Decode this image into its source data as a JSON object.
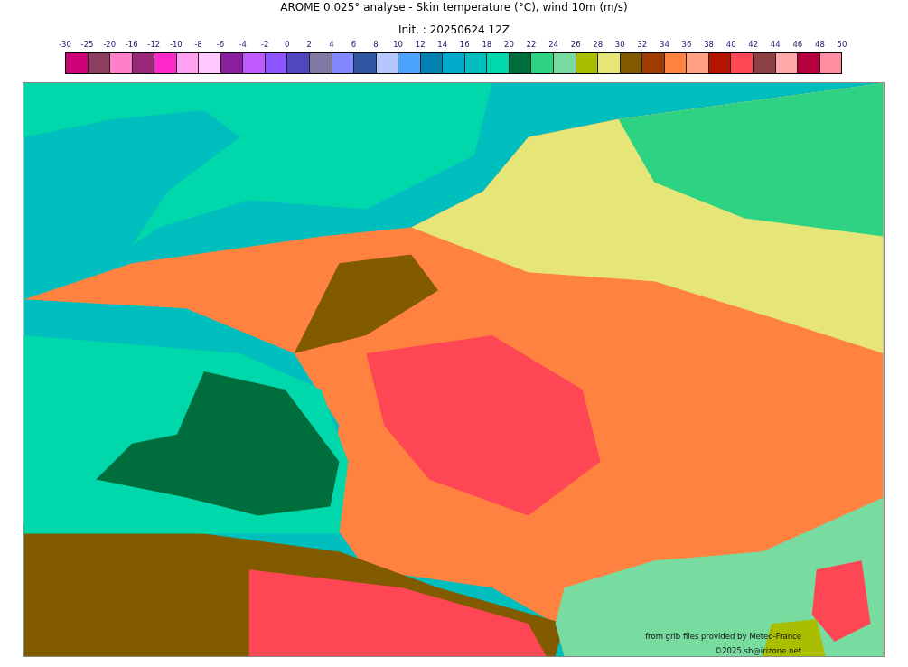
{
  "title": "AROME 0.025° analyse - Skin temperature (°C), wind 10m (m/s)",
  "subtitle": "Init. : 20250624 12Z",
  "colorbar": {
    "ticks": [
      "-30",
      "-25",
      "-20",
      "-16",
      "-12",
      "-10",
      "-8",
      "-6",
      "-4",
      "-2",
      "0",
      "2",
      "4",
      "6",
      "8",
      "10",
      "12",
      "14",
      "16",
      "18",
      "20",
      "22",
      "24",
      "26",
      "28",
      "30",
      "32",
      "34",
      "36",
      "38",
      "40",
      "42",
      "44",
      "46",
      "48",
      "50"
    ],
    "swatches": [
      {
        "color": "#cc0077"
      },
      {
        "color": "#8b3f5e"
      },
      {
        "color": "#ff80c8"
      },
      {
        "color": "#9a2878"
      },
      {
        "color": "#ff28c8"
      },
      {
        "color": "#ffa0f0"
      },
      {
        "color": "#ffc8ff"
      },
      {
        "color": "#8c1ea0"
      },
      {
        "color": "#be5aff"
      },
      {
        "color": "#8c55ff"
      },
      {
        "color": "#5046be"
      },
      {
        "color": "#8078a5"
      },
      {
        "color": "#8087ff"
      },
      {
        "color": "#2d55a0"
      },
      {
        "color": "#b4c8ff"
      },
      {
        "color": "#4ba5ff"
      },
      {
        "color": "#0082b4"
      },
      {
        "color": "#00aacd"
      },
      {
        "color": "#00bebe"
      },
      {
        "color": "#00d7aa"
      },
      {
        "color": "#006e3c"
      },
      {
        "color": "#2dd282"
      },
      {
        "color": "#78dca0"
      },
      {
        "color": "#aabe00"
      },
      {
        "color": "#e6e678"
      },
      {
        "color": "#825a00"
      },
      {
        "color": "#a03c00"
      },
      {
        "color": "#ff8240"
      },
      {
        "color": "#ffa082"
      },
      {
        "color": "#b41400"
      },
      {
        "color": "#ff4655"
      },
      {
        "color": "#8c4146"
      },
      {
        "color": "#ffaaaa"
      },
      {
        "color": "#b4003c"
      },
      {
        "color": "#ff8ca0"
      }
    ]
  },
  "map": {
    "credits": [
      "from grib files provided by Meteo-France",
      "©2025 sb@irizone.net"
    ]
  }
}
